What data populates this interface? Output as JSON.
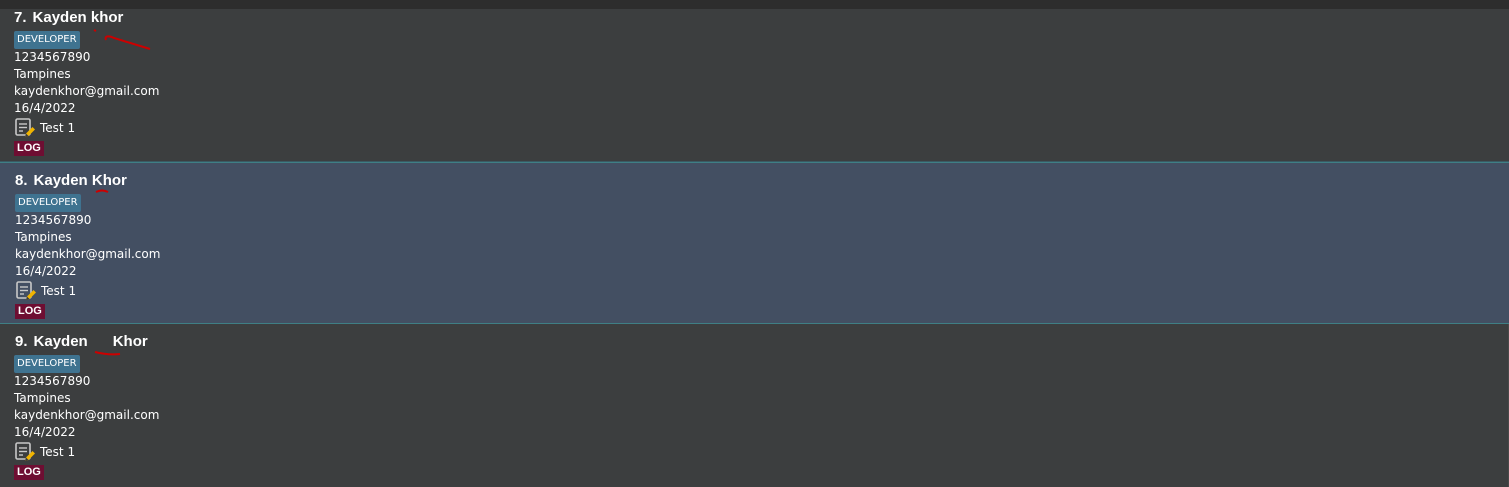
{
  "persons": [
    {
      "index": "7.",
      "name": "Kayden khor",
      "tag": "DEVELOPER",
      "phone": "1234567890",
      "address": "Tampines",
      "email": "kaydenkhor@gmail.com",
      "date": "16/4/2022",
      "remark_icon": "note-edit-icon",
      "remark": "Test 1",
      "label": "LOG"
    },
    {
      "index": "8.",
      "name": "Kayden Khor",
      "tag": "DEVELOPER",
      "phone": "1234567890",
      "address": "Tampines",
      "email": "kaydenkhor@gmail.com",
      "date": "16/4/2022",
      "remark_icon": "note-edit-icon",
      "remark": "Test 1",
      "label": "LOG"
    },
    {
      "index": "9.",
      "name": "Kayden      Khor",
      "tag": "DEVELOPER",
      "phone": "1234567890",
      "address": "Tampines",
      "email": "kaydenkhor@gmail.com",
      "date": "16/4/2022",
      "remark_icon": "note-edit-icon",
      "remark": "Test 1",
      "label": "LOG"
    }
  ],
  "colors": {
    "card_bg": "#3c3e3f",
    "selected_bg": "#434f62",
    "tag_bg": "#3f7390",
    "label_bg": "#6e0e32",
    "annotation": "#cc0000"
  }
}
